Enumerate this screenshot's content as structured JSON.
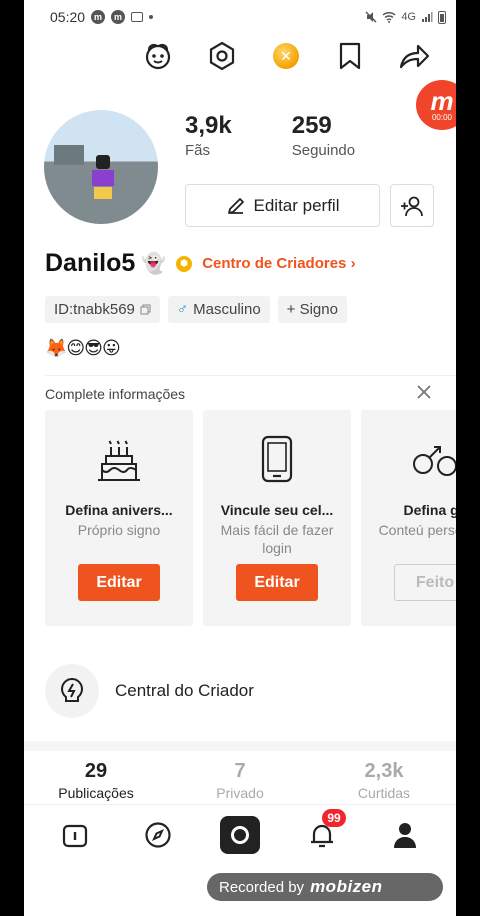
{
  "status_bar": {
    "time": "05:20",
    "signal_text": "4G"
  },
  "colors": {
    "accent": "#f0541e",
    "badge_red": "#f0262e"
  },
  "top_icons": [
    "face-icon",
    "settings-hex-icon",
    "coin-icon",
    "bookmark-icon",
    "share-icon"
  ],
  "recorder_badge": {
    "logo": "m",
    "timer": "00:00"
  },
  "profile": {
    "fans_count": "3,9k",
    "fans_label": "Fãs",
    "following_count": "259",
    "following_label": "Seguindo",
    "edit_label": "Editar perfil",
    "name": "Danilo5",
    "name_emoji": "👻",
    "creator_center_label": "Centro de Criadores ›",
    "tags": {
      "id": "ID:tnabk569",
      "gender": "Masculino",
      "sign": "+ Signo"
    },
    "emojis": "🦊😊😎😛"
  },
  "complete_info": {
    "title": "Complete informações",
    "cards": [
      {
        "title": "Defina anivers...",
        "subtitle": "Próprio signo",
        "button": "Editar"
      },
      {
        "title": "Vincule seu cel...",
        "subtitle": "Mais fácil de fazer  login",
        "button": "Editar"
      },
      {
        "title": "Defina gê",
        "subtitle": "Conteú personaliz",
        "button": "Feito"
      }
    ]
  },
  "creator_central": {
    "label": "Central do Criador"
  },
  "content_tabs": [
    {
      "count": "29",
      "label": "Publicações"
    },
    {
      "count": "7",
      "label": "Privado"
    },
    {
      "count": "2,3k",
      "label": "Curtidas"
    }
  ],
  "bottom_nav": {
    "notification_count": "99"
  },
  "watermark": {
    "prefix": "Recorded by",
    "brand": "mobizen"
  }
}
